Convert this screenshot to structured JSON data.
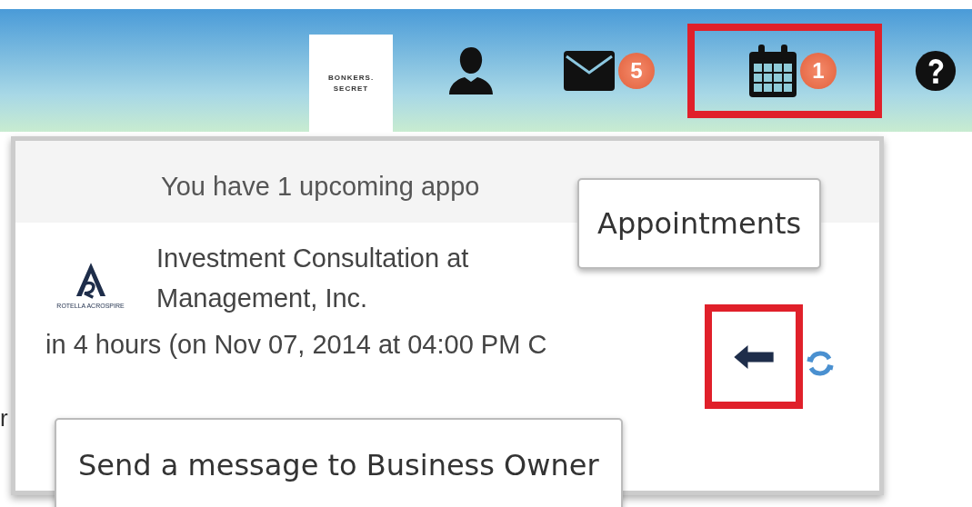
{
  "header": {
    "logo": {
      "lines": [
        "BONKERS.",
        "SECRET"
      ]
    },
    "nav": [
      {
        "kind": "profile",
        "highlighted": false
      },
      {
        "kind": "messages",
        "badge": "5",
        "highlighted": false
      },
      {
        "kind": "appointments",
        "badge": "1",
        "highlighted": true
      },
      {
        "kind": "help",
        "highlighted": false
      }
    ]
  },
  "background_fragment": "r",
  "dropdown": {
    "summary": "You have 1 upcoming appo",
    "appointment": {
      "logo_caption": "ROTELLA ACROSPIRE",
      "title_lines": [
        "Investment Consultation at",
        "Management, Inc."
      ],
      "when": "in 4 hours (on Nov 07, 2014 at 04:00 PM C",
      "send_highlighted": true
    }
  },
  "tooltips": [
    {
      "kind": "top",
      "text": "Appointments"
    },
    {
      "kind": "bottom",
      "text": "Send a message to Business Owner"
    }
  ]
}
